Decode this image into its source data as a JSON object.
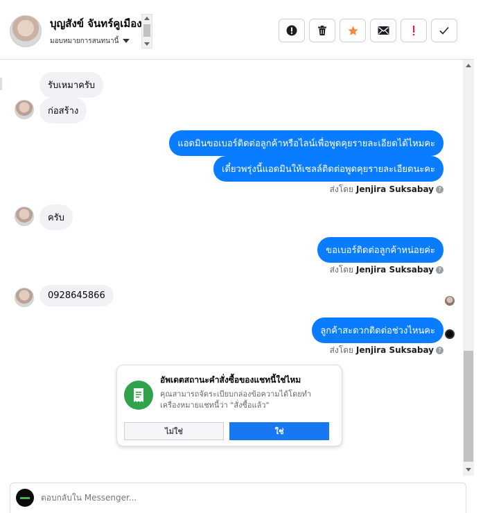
{
  "header": {
    "name": "บุญสังข์ จันทร์คูเมือง",
    "assign_label": "มอบหมายการสนทนานี้",
    "tools": [
      {
        "name": "report-icon",
        "color": "#1c1e21"
      },
      {
        "name": "trash-icon",
        "color": "#1c1e21"
      },
      {
        "name": "star-icon",
        "color": "#f0883e"
      },
      {
        "name": "mail-icon",
        "color": "#1c1e21"
      },
      {
        "name": "exclaim-icon",
        "color": "#e41e3f"
      },
      {
        "name": "check-icon",
        "color": "#1c1e21"
      }
    ]
  },
  "messages": {
    "in1": "รับเหมาครับ",
    "in2": "ก่อสร้าง",
    "out1": "แอดมินขอเบอร์ติดต่อลูกค้าหรือไลน์เพื่อพูดคุยรายละเอียดได้ไหมคะ",
    "out2": "เดี๋ยวพรุ่งนี้แอดมินให้เซลล์ติดต่อพูดคุยรายละเอียดนะคะ",
    "in3": "ครับ",
    "out3": "ขอเบอร์ติดต่อลูกค้าหน่อยค่ะ",
    "in4": "0928645866",
    "out4": "ลูกค้าสะดวกติดต่อช่วงไหนคะ"
  },
  "sent_by": {
    "prefix": "ส่งโดย",
    "agent": "Jenjira Suksabay",
    "help": "?"
  },
  "card": {
    "title": "อัพเดตสถานะคำสั่งซื้อของแชทนี้ใช่ไหม",
    "desc": "คุณสามารถจัดระเบียบกล่องข้อความได้โดยทำเครื่องหมายแชทนี้ว่า \"สั่งซื้อแล้ว\"",
    "no_label": "ไม่ใช่",
    "yes_label": "ใช่"
  },
  "composer": {
    "placeholder": "ตอบกลับใน Messenger..."
  },
  "colors": {
    "outgoing": "#0a7cff",
    "incoming": "#f0f2f5",
    "accent": "#1877f2",
    "card_icon": "#31a24c"
  }
}
